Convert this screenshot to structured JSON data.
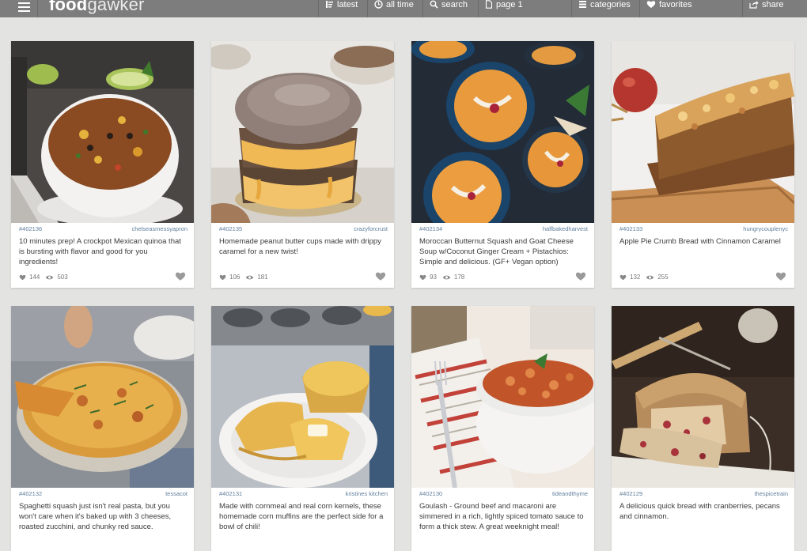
{
  "app": {
    "logo_bold": "food",
    "logo_light": "gawker"
  },
  "nav": {
    "menu_icon": "hamburger-menu-icon",
    "items": [
      {
        "label": "latest",
        "icon": "bar-list-icon"
      },
      {
        "label": "all time",
        "icon": "clock-icon"
      },
      {
        "label": "search",
        "icon": "search-icon"
      },
      {
        "label": "page 1",
        "icon": "page-icon"
      },
      {
        "label": "categories",
        "icon": "categories-icon"
      },
      {
        "label": "favorites",
        "icon": "heart-icon"
      },
      {
        "label": "share",
        "icon": "share-icon"
      }
    ]
  },
  "cards": [
    {
      "id": "#402136",
      "user": "chelseasmessyapron",
      "desc": "10 minutes prep! A crockpot Mexican quinoa that is bursting with flavor and good for you ingredients!",
      "likes": "144",
      "views": "503"
    },
    {
      "id": "#402135",
      "user": "crazyforcrust",
      "desc": "Homemade peanut butter cups made with drippy caramel for a new twist!",
      "likes": "106",
      "views": "181"
    },
    {
      "id": "#402134",
      "user": "halfbakedharvest",
      "desc": "Moroccan Butternut Squash and Goat Cheese Soup w/Coconut Ginger Cream + Pistachios: Simple and delicious. (GF+ Vegan option)",
      "likes": "93",
      "views": "178"
    },
    {
      "id": "#402133",
      "user": "hungrycouplenyc",
      "desc": "Apple Pie Crumb Bread with Cinnamon Caramel",
      "likes": "132",
      "views": "255"
    },
    {
      "id": "#402132",
      "user": "tessacot",
      "desc": "Spaghetti squash just isn't real pasta, but you won't care when it's baked up with 3 cheeses, roasted zucchini, and chunky red sauce.",
      "likes": "",
      "views": ""
    },
    {
      "id": "#402131",
      "user": "kristines kitchen",
      "desc": "Made with cornmeal and real corn kernels, these homemade corn muffins are the perfect side for a bowl of chili!",
      "likes": "",
      "views": ""
    },
    {
      "id": "#402130",
      "user": "tideandthyme",
      "desc": "Goulash - Ground beef and macaroni are simmered in a rich, lightly spiced tomato sauce to form a thick stew. A great weeknight meal!",
      "likes": "",
      "views": ""
    },
    {
      "id": "#402129",
      "user": "thespicetrain",
      "desc": "A delicious quick bread with cranberries, pecans and cinnamon.",
      "likes": "",
      "views": ""
    }
  ],
  "colors": {
    "nav_bg": "#7d7d7d",
    "page_bg": "#e3e3e1",
    "meta_link": "#607f9c"
  }
}
